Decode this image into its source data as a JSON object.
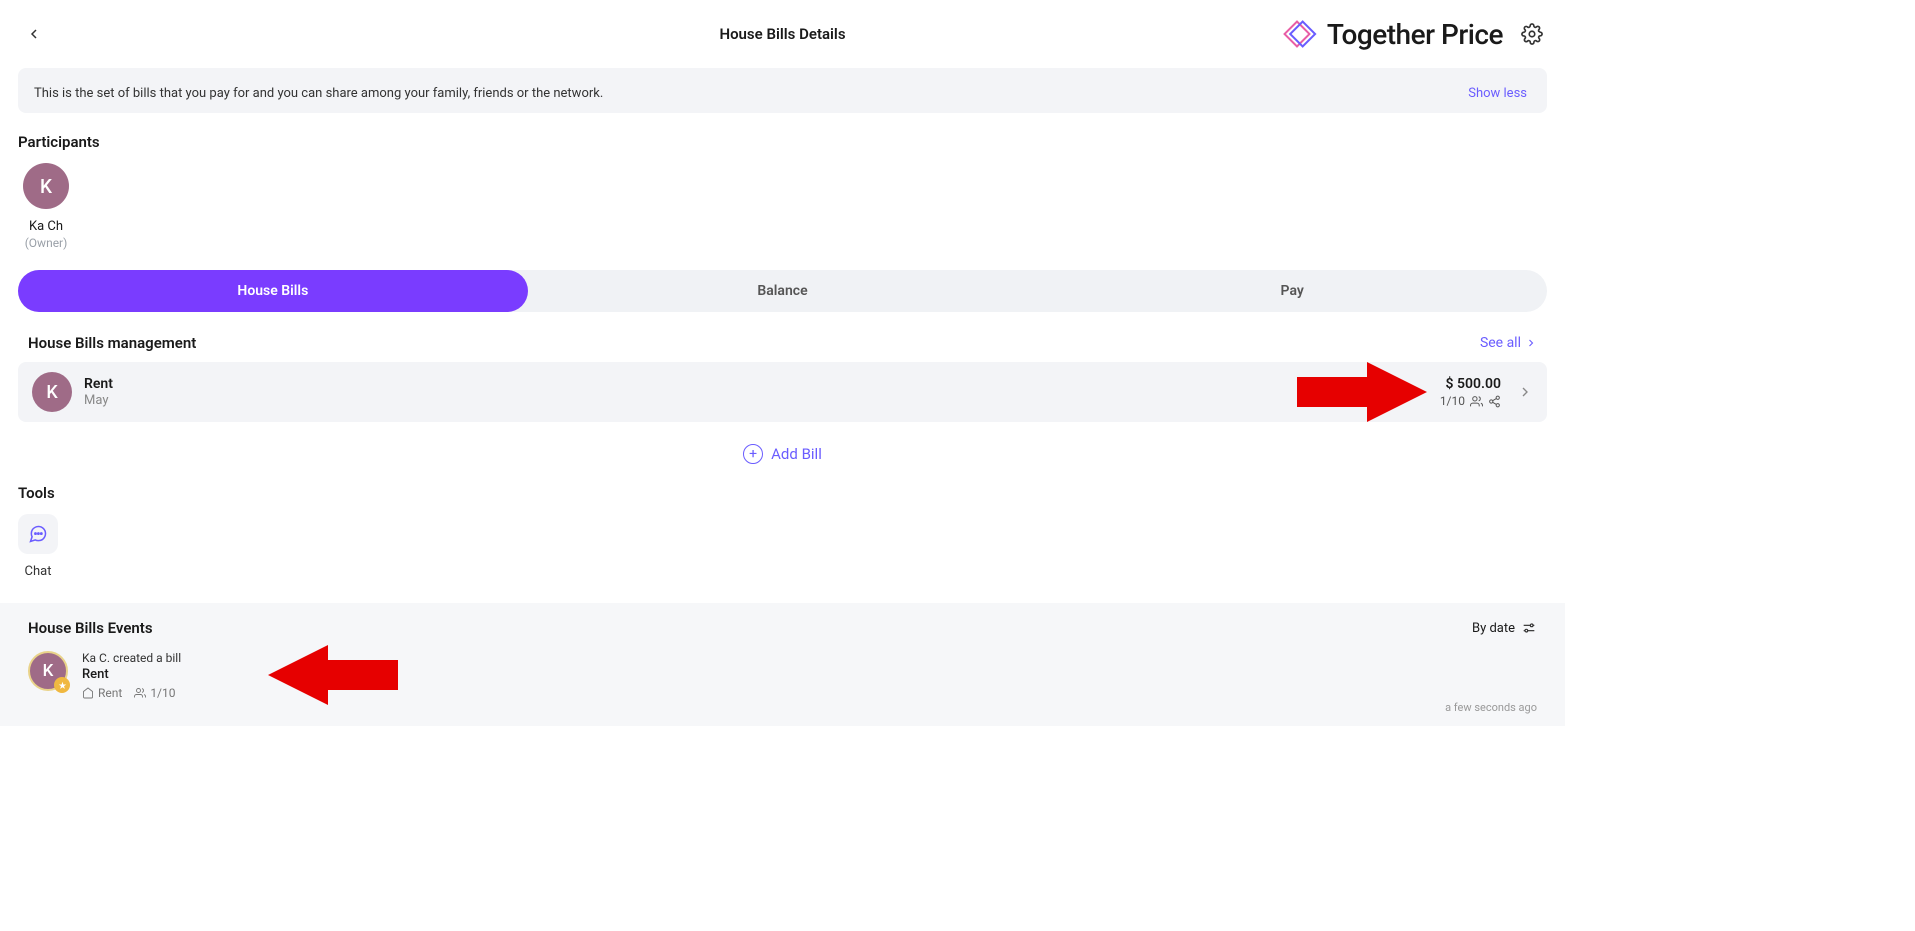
{
  "header": {
    "page_title": "House Bills Details",
    "brand": "Together Price"
  },
  "info_bar": {
    "text": "This is the set of bills that you pay for and you can share among your family, friends or the network.",
    "toggle": "Show less"
  },
  "participants": {
    "title": "Participants",
    "items": [
      {
        "initial": "K",
        "name": "Ka Ch",
        "role": "(Owner)"
      }
    ]
  },
  "tabs": [
    {
      "label": "House Bills",
      "active": true
    },
    {
      "label": "Balance",
      "active": false
    },
    {
      "label": "Pay",
      "active": false
    }
  ],
  "management": {
    "title": "House Bills management",
    "see_all": "See all",
    "bills": [
      {
        "initial": "K",
        "name": "Rent",
        "month": "May",
        "amount": "$ 500.00",
        "ratio": "1/10"
      }
    ],
    "add_label": "Add Bill"
  },
  "tools": {
    "title": "Tools",
    "items": [
      {
        "label": "Chat"
      }
    ]
  },
  "events": {
    "title": "House Bills Events",
    "sort_label": "By date",
    "items": [
      {
        "avatar_initial": "K",
        "line1": "Ka C. created a bill",
        "line2": "Rent",
        "meta_rent": "Rent",
        "meta_ratio": "1/10",
        "time": "a few seconds ago"
      }
    ]
  }
}
